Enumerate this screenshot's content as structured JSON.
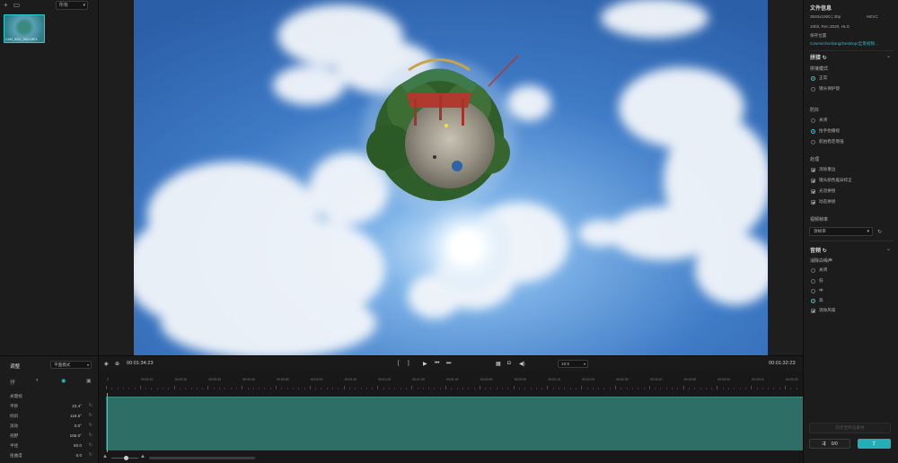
{
  "left_panel": {
    "filter": "所有",
    "media_name": "CAM_0001_0001.MP4"
  },
  "viewer": {
    "scene": "360-little-planet"
  },
  "right_panel": {
    "file_info": {
      "title": "文件信息",
      "line1": "3840x1920 | 30p",
      "codec": "HEVC",
      "line2": "10bit, Rec.2020, HLG",
      "location_label": "保存位置",
      "location_path": "/Users/chenliang/Desktop/全景视频..."
    },
    "stitch": {
      "title": "拼接",
      "mode_label": "拼接模式",
      "mode_options": [
        {
          "label": "正常",
          "selected": true
        },
        {
          "label": "镜头保护镜",
          "selected": false
        }
      ],
      "stabilization_label": "防抖",
      "stabilization_options": [
        {
          "label": "关闭",
          "selected": false
        },
        {
          "label": "抬手抬播视",
          "selected": true
        },
        {
          "label": "航拍稳定增强",
          "selected": false
        }
      ],
      "processing_label": "处理",
      "processing_options": [
        {
          "label": "消除重边",
          "checked": true
        },
        {
          "label": "镜头颜色差异校正",
          "checked": true
        },
        {
          "label": "光流拼接",
          "checked": true
        },
        {
          "label": "动态拼接",
          "checked": true
        }
      ],
      "fps_label": "视频帧率",
      "fps_value": "源帧率"
    },
    "audio": {
      "title": "音频",
      "denoise_label": "消除白噪声",
      "denoise_options": [
        {
          "label": "关闭",
          "selected": false
        },
        {
          "label": "低",
          "selected": false
        },
        {
          "label": "中",
          "selected": false
        },
        {
          "label": "高",
          "selected": true
        }
      ],
      "wind_label": "消除风噪",
      "wind_checked": true
    },
    "sync_button": "同步至所选素材",
    "queue_count": "0/0"
  },
  "adjust_panel": {
    "title": "调整",
    "mode": "平面模式",
    "tab_label": "拼",
    "keyframe_label": "关键帧",
    "params": [
      {
        "label": "平移",
        "value": "23.4°"
      },
      {
        "label": "倾斜",
        "value": "118.5°"
      },
      {
        "label": "滚动",
        "value": "0.0°"
      },
      {
        "label": "视野",
        "value": "165.0°"
      },
      {
        "label": "半径",
        "value": "50.0"
      },
      {
        "label": "扭曲度",
        "value": "0.0"
      }
    ]
  },
  "transport": {
    "current_time": "00:01:34:23",
    "total_time": "00:01:32:23",
    "ratio": "16:9"
  },
  "timeline": {
    "ruler": [
      "0",
      "00:00:10",
      "00:00:20",
      "00:00:30",
      "00:00:40",
      "00:00:50",
      "00:01:00",
      "00:01:10",
      "00:01:20",
      "00:01:30",
      "00:01:40",
      "00:01:50",
      "00:02:00",
      "00:02:10",
      "00:02:20",
      "00:02:30",
      "00:02:40",
      "00:02:50",
      "00:03:00",
      "00:03:10",
      "00:03:20",
      "00:03:30"
    ]
  },
  "colors": {
    "accent": "#2ecad1",
    "track": "#2d6e67",
    "export": "#24aeb8"
  }
}
